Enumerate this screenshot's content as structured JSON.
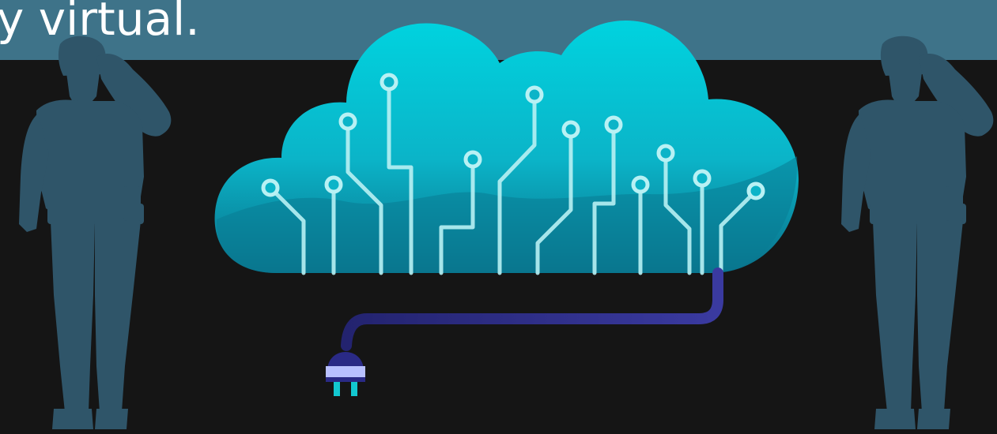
{
  "banner": {
    "text": "y virtual."
  },
  "colors": {
    "background": "#151515",
    "banner": "#3e7389",
    "soldier": "#2f5569",
    "cloud_top": "#00d3df",
    "cloud_bottom": "#0a6f88",
    "circuit": "#b8f1f4",
    "cable": "#33338f",
    "plug_prongs": "#12c7d0"
  },
  "icons": {
    "cloud": "cloud-icon",
    "plug": "plug-icon",
    "soldier": "saluting-soldier-silhouette"
  }
}
